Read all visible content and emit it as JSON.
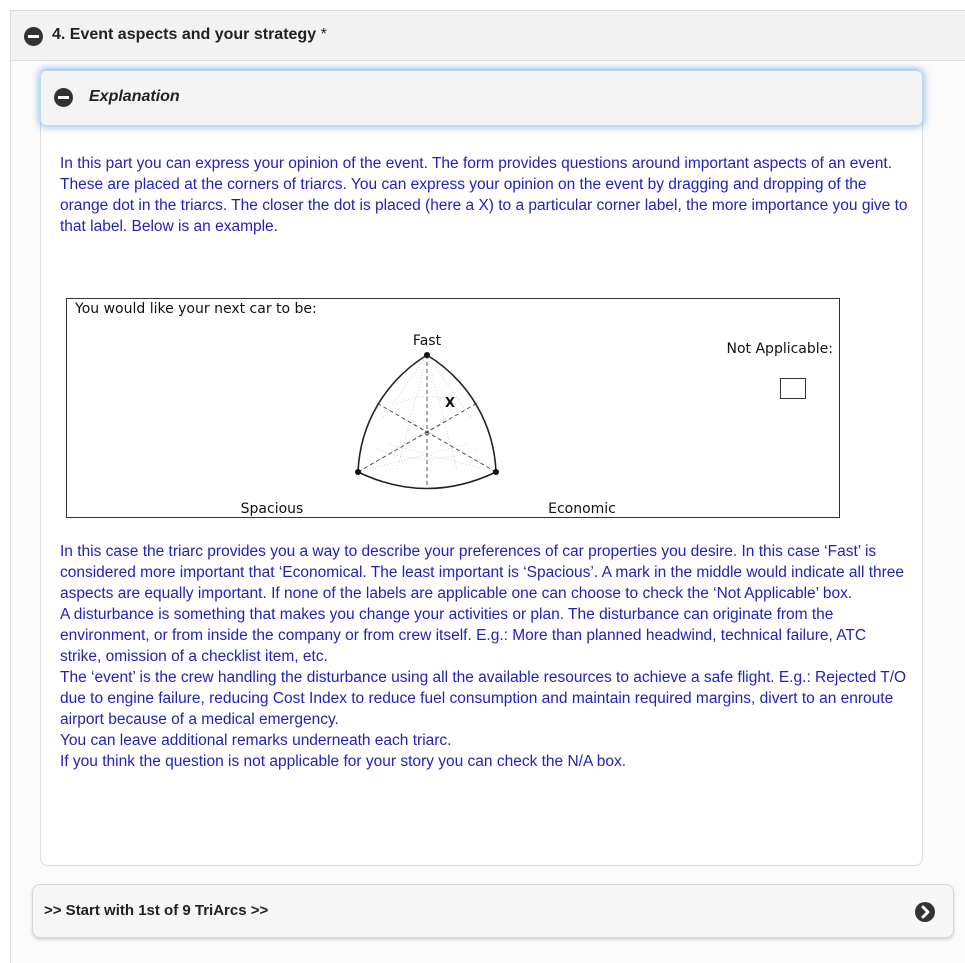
{
  "section": {
    "title": "4. Event aspects and your strategy",
    "required_marker": "*",
    "icon": "minus-circle-icon"
  },
  "explanation": {
    "title": "Explanation",
    "icon": "minus-circle-icon",
    "intro": "In this part you can express your opinion of the event. The form provides questions around important aspects of an event. These are placed at the corners of triarcs. You can express your opinion on the event by dragging and dropping of the orange dot in the triarcs. The closer the dot is placed (here a X) to a particular corner label, the more importance you give to that label. Below is an example.",
    "example": {
      "prompt": "You would like your next car to be:",
      "corner_top": "Fast",
      "corner_left": "Spacious",
      "corner_right": "Economic",
      "marker": "X",
      "not_applicable_label": "Not Applicable:",
      "not_applicable_checked": false
    },
    "paragraphs": [
      "In this case the triarc provides you a way to describe your preferences of car properties you desire. In this case ‘Fast’ is considered more important that ‘Economical. The least important is ‘Spacious’. A mark in the middle would indicate all three aspects are equally important. If none of the labels are applicable one can choose to check the ‘Not Applicable’ box.",
      "A disturbance is something that makes you change your activities or plan. The disturbance can originate from the environment, or from inside the company or from crew itself. E.g.: More than planned headwind, technical failure, ATC strike, omission of a checklist item, etc.",
      "The ‘event’ is the crew handling the disturbance using all the available resources to achieve a safe flight. E.g.: Rejected T/O due to engine failure, reducing Cost Index to reduce fuel consumption and maintain required margins, divert to an enroute airport because of a medical emergency.",
      "You can leave additional remarks underneath each triarc.",
      "If you think the question is not applicable for your story you can check the N/A box."
    ]
  },
  "start_button": {
    "label": ">> Start with 1st of 9 TriArcs >>",
    "icon": "arrow-right-circle-icon"
  },
  "colors": {
    "text_blue": "#2222bb",
    "header_bg": "#f2f2f2",
    "icon_dark": "#333333",
    "focus_glow": "#78afe6"
  }
}
